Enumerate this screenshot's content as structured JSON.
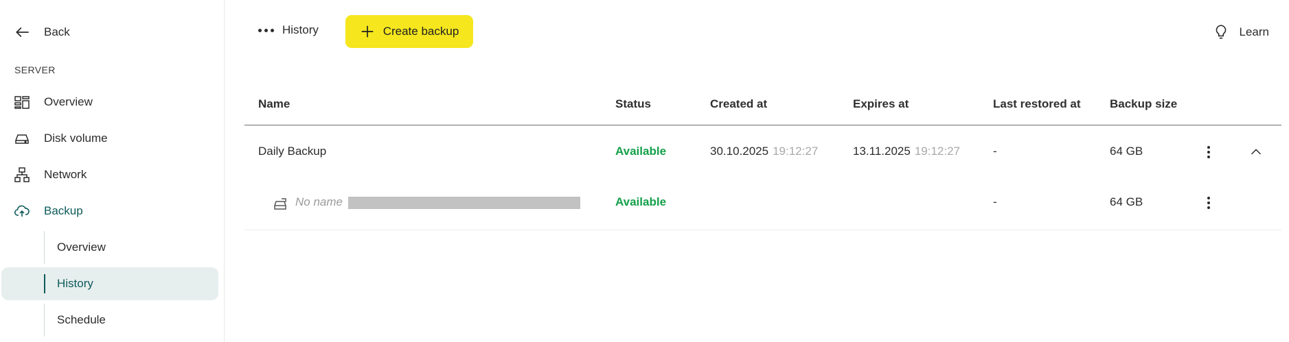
{
  "sidebar": {
    "back_label": "Back",
    "section_label": "SERVER",
    "items": [
      {
        "label": "Overview",
        "icon": "grid-icon"
      },
      {
        "label": "Disk volume",
        "icon": "disk-icon"
      },
      {
        "label": "Network",
        "icon": "network-icon"
      },
      {
        "label": "Backup",
        "icon": "cloud-upload-icon"
      }
    ],
    "sub_items": [
      {
        "label": "Overview"
      },
      {
        "label": "History"
      },
      {
        "label": "Schedule"
      }
    ]
  },
  "toolbar": {
    "history_label": "History",
    "create_label": "Create backup",
    "learn_label": "Learn"
  },
  "table": {
    "columns": [
      "Name",
      "Status",
      "Created at",
      "Expires at",
      "Last restored at",
      "Backup size"
    ],
    "rows": [
      {
        "name": "Daily Backup",
        "status": "Available",
        "created_date": "30.10.2025",
        "created_time": "19:12:27",
        "expires_date": "13.11.2025",
        "expires_time": "19:12:27",
        "last_restored": "-",
        "size": "64 GB"
      },
      {
        "name": "No name",
        "status": "Available",
        "last_restored": "-",
        "size": "64 GB"
      }
    ]
  },
  "colors": {
    "accent_yellow": "#f5e61e",
    "active_teal": "#0e5a5a",
    "status_green": "#14a04a"
  }
}
